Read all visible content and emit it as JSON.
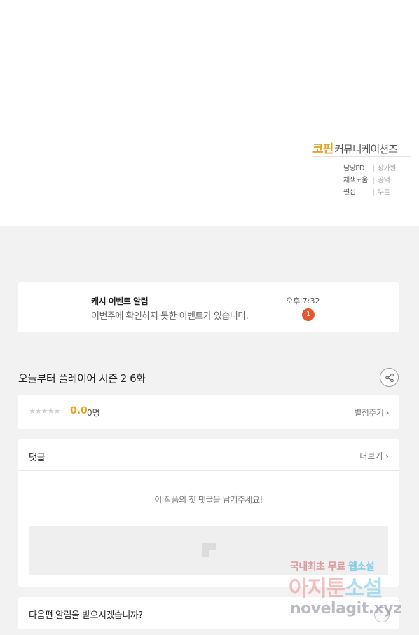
{
  "credits": {
    "brand": "코핀",
    "company": "커뮤니케이션즈",
    "rows": [
      {
        "role": "담당PD",
        "sep": "|",
        "name": "장가원"
      },
      {
        "role": "채색도움",
        "sep": "|",
        "name": "공덕"
      },
      {
        "role": "편집",
        "sep": "|",
        "name": "두늘"
      }
    ]
  },
  "notice": {
    "title": "캐시 이벤트 알림",
    "body": "이번주에 확인하지 못한 이벤트가 있습니다.",
    "time": "오후 7:32",
    "badge": "1"
  },
  "episode": {
    "title": "오늘부터 플레이어 시즌 2 6화",
    "share_icon": "share-icon"
  },
  "rating": {
    "stars": "★★★★★",
    "score": "0.0",
    "count": "0명",
    "rate_link": "별점주기 ›"
  },
  "comments": {
    "title": "댓글",
    "more": "더보기 ›",
    "empty": "이 작품의 첫 댓글을 남겨주세요!"
  },
  "next_alert": {
    "title": "다음편 알림을 받으시겠습니까?"
  },
  "watermark": {
    "line1_a": "국내최초 무료 ",
    "line1_b": "웹소설",
    "line2_a": "아지툰",
    "line2_b": "소설",
    "line3": "novelagit.xyz"
  },
  "colors": {
    "brand_gold": "#e0a526",
    "rating_orange": "#e8a21c",
    "badge_red": "#e2572d",
    "background": "#f2f2f3"
  }
}
